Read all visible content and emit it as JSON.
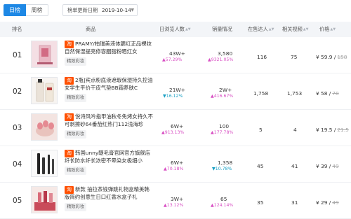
{
  "toolbar": {
    "tabs": [
      {
        "label": "日榜",
        "active": true
      },
      {
        "label": "周榜",
        "active": false
      }
    ],
    "date_label": "榜单更新日期",
    "date_value": "2019-10-14"
  },
  "columns": {
    "rank": "排名",
    "product": "商品",
    "views": "日浏览人数",
    "sales": "销量情况",
    "on_sale": "在售达人",
    "videos": "相关视频",
    "price": "价格"
  },
  "colors": {
    "accent": "#1e88e5",
    "up": "#d84fc3",
    "down": "#1aa0c4",
    "taobao": "#ff5000"
  },
  "rows": [
    {
      "rank": "01",
      "thumb_icon": "lipstick-box-image",
      "source_icon": "taobao-badge",
      "source": "淘",
      "title": "PRAMY/柏瑞美液体腮红正品裸妆自然保湿提亮修容胭脂粉晒红女",
      "tag": "精致彩妆",
      "views": "43W+",
      "views_change": "▲57.29%",
      "views_trend": "up",
      "sales": "3,580",
      "sales_change": "▲9321.05%",
      "sales_trend": "up",
      "on_sale": "116",
      "videos": "75",
      "price": "¥ 59.9 /",
      "price_orig": "158"
    },
    {
      "rank": "02",
      "thumb_icon": "foundation-bottle-image",
      "source_icon": "taobao-badge",
      "source": "淘",
      "title": "2瓶|宾点粉底液遮瑕保湿持久控油女学生平价干皮气垫BB霜养肤C",
      "tag": "精致彩妆",
      "views": "21W+",
      "views_change": "▼16.12%",
      "views_trend": "down",
      "sales": "2W+",
      "sales_change": "▲416.67%",
      "sales_trend": "up",
      "on_sale": "1,758",
      "videos": "1,753",
      "price": "¥ 58 /",
      "price_orig": "78"
    },
    {
      "rank": "03",
      "thumb_icon": "nail-polish-image",
      "source_icon": "taobao-badge",
      "source": "淘",
      "title": "悦诗风吟指甲油秋冬免烤女持久不可剥擦砂64番茄红热门112浅海珍",
      "tag": "精致彩妆",
      "views": "6W+",
      "views_change": "▲913.13%",
      "views_trend": "up",
      "sales": "100",
      "sales_change": "▲177.78%",
      "sales_trend": "up",
      "on_sale": "5",
      "videos": "4",
      "price": "¥ 19.5 /",
      "price_orig": "21.5"
    },
    {
      "rank": "04",
      "thumb_icon": "mascara-image",
      "source_icon": "taobao-badge",
      "source": "淘",
      "title": "韩国unny睫毛膏官网官方旗舰店纤长防水纤长浓密不晕染女极细小",
      "tag": "精致彩妆",
      "views": "6W+",
      "views_change": "▲70.18%",
      "views_trend": "up",
      "sales": "1,358",
      "sales_change": "▼10.78%",
      "sales_trend": "down",
      "on_sale": "45",
      "videos": "41",
      "price": "¥ 39 /",
      "price_orig": "49"
    },
    {
      "rank": "05",
      "thumb_icon": "lipstick-gift-image",
      "source_icon": "taobao-badge",
      "source": "淘",
      "title": "新款 抽拉茶钱弹跳礼物盒精美韩版简约创意生日口红香水盒子礼",
      "tag": "精致彩妆",
      "views": "3W+",
      "views_change": "▲13.12%",
      "views_trend": "up",
      "sales": "65",
      "sales_change": "▲124.14%",
      "sales_trend": "up",
      "on_sale": "35",
      "videos": "31",
      "price": "¥ 29 /",
      "price_orig": "49"
    }
  ]
}
